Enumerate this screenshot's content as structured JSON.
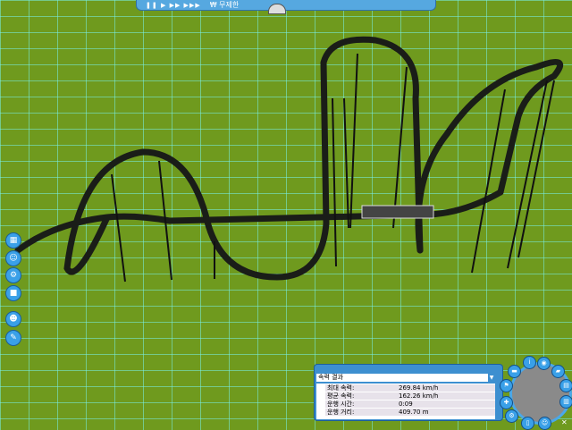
{
  "topbar": {
    "controls": "❚❚ ▶ ▶▶ ▶▶▶",
    "money": "₩ 무제한"
  },
  "left_toolbar": [
    "map-icon",
    "guests-icon",
    "rides-icon",
    "park-icon",
    "staff-icon",
    "tools-icon"
  ],
  "ride_panel": {
    "title": "속력 결과",
    "stats": [
      {
        "label": "최대 속력:",
        "value": "269.84 km/h"
      },
      {
        "label": "평균 속력:",
        "value": "162.26 km/h"
      },
      {
        "label": "운행 시간:",
        "value": "0:09"
      },
      {
        "label": "운행 거리:",
        "value": "409.70 m"
      }
    ]
  },
  "colors": {
    "grass": "#6f9a1e",
    "grid": "#78f0e6",
    "ui": "#3d8fd0"
  }
}
